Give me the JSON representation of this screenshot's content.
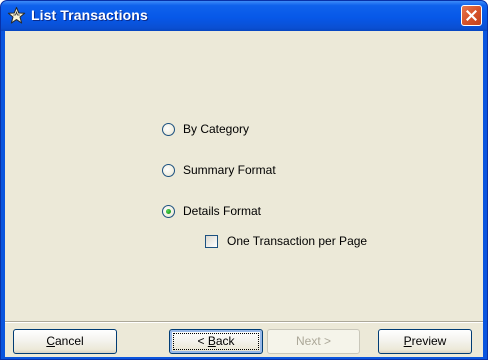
{
  "window": {
    "title": "List Transactions",
    "title_icon": "star-icon",
    "close_icon": "close-icon"
  },
  "options": [
    {
      "label": "By Category",
      "type": "radio",
      "checked": false
    },
    {
      "label": "Summary Format",
      "type": "radio",
      "checked": false
    },
    {
      "label": "Details Format",
      "type": "radio",
      "checked": true
    },
    {
      "label": "One Transaction per Page",
      "type": "checkbox",
      "checked": false
    }
  ],
  "buttons": {
    "cancel": {
      "mnemonic": "C",
      "rest": "ancel"
    },
    "back": {
      "prefix": "< ",
      "mnemonic": "B",
      "rest": "ack"
    },
    "next": {
      "label": "Next >",
      "enabled": false
    },
    "preview": {
      "mnemonic": "P",
      "rest": "review"
    }
  },
  "colors": {
    "titlebar": "#0758e8",
    "dialog_bg": "#ece9d8",
    "close_button": "#d6532b",
    "radio_dot": "#21a121"
  }
}
